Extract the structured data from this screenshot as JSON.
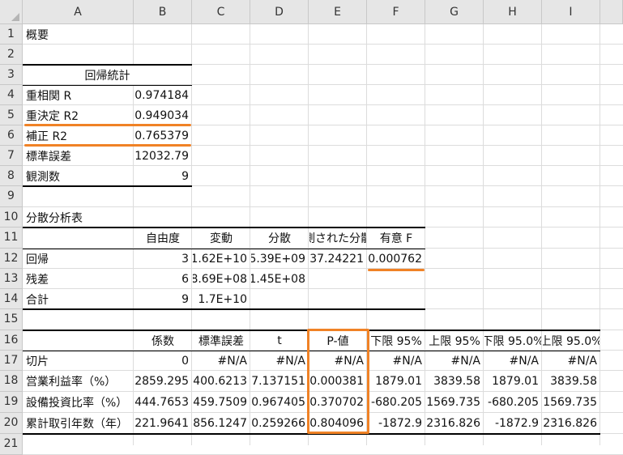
{
  "colors": {
    "highlight": "#f08226",
    "header_bg": "#e6e6e6",
    "grid": "#dcdcdc"
  },
  "columns": [
    "A",
    "B",
    "C",
    "D",
    "E",
    "F",
    "G",
    "H",
    "I"
  ],
  "rows": [
    "1",
    "2",
    "3",
    "4",
    "5",
    "6",
    "7",
    "8",
    "9",
    "10",
    "11",
    "12",
    "13",
    "14",
    "15",
    "16",
    "17",
    "18",
    "19",
    "20",
    "21"
  ],
  "cells": {
    "a1": "概要",
    "a3": "回帰統計",
    "a4": "重相関 R",
    "b4": "0.974184",
    "a5": "重決定 R2",
    "b5": "0.949034",
    "a6": "補正 R2",
    "b6": "0.765379",
    "a7": "標準誤差",
    "b7": "12032.79",
    "a8": "観測数",
    "b8": "9",
    "a10": "分散分析表",
    "b11": "自由度",
    "c11": "変動",
    "d11": "分散",
    "e11": "観測された分散比",
    "f11": "有意 F",
    "a12": "回帰",
    "b12": "3",
    "c12": "1.62E+10",
    "d12": "5.39E+09",
    "e12": "37.24221",
    "f12": "0.000762",
    "a13": "残差",
    "b13": "6",
    "c13": "8.69E+08",
    "d13": "1.45E+08",
    "a14": "合計",
    "b14": "9",
    "c14": "1.7E+10",
    "b16": "係数",
    "c16": "標準誤差",
    "d16": "t",
    "e16": "P-値",
    "f16": "下限 95%",
    "g16": "上限 95%",
    "h16": "下限 95.0%",
    "i16": "上限 95.0%",
    "a17": "切片",
    "b17": "0",
    "c17": "#N/A",
    "d17": "#N/A",
    "e17": "#N/A",
    "f17": "#N/A",
    "g17": "#N/A",
    "h17": "#N/A",
    "i17": "#N/A",
    "a18": "営業利益率（%）",
    "b18": "2859.295",
    "c18": "400.6213",
    "d18": "7.137151",
    "e18": "0.000381",
    "f18": "1879.01",
    "g18": "3839.58",
    "h18": "1879.01",
    "i18": "3839.58",
    "a19": "設備投資比率（%）",
    "b19": "444.7653",
    "c19": "459.7509",
    "d19": "0.967405",
    "e19": "0.370702",
    "f19": "-680.205",
    "g19": "1569.735",
    "h19": "-680.205",
    "i19": "1569.735",
    "a20": "累計取引年数（年）",
    "b20": "221.9641",
    "c20": "856.1247",
    "d20": "0.259266",
    "e20": "0.804096",
    "f20": "-1872.9",
    "g20": "2316.826",
    "h20": "-1872.9",
    "i20": "2316.826"
  }
}
